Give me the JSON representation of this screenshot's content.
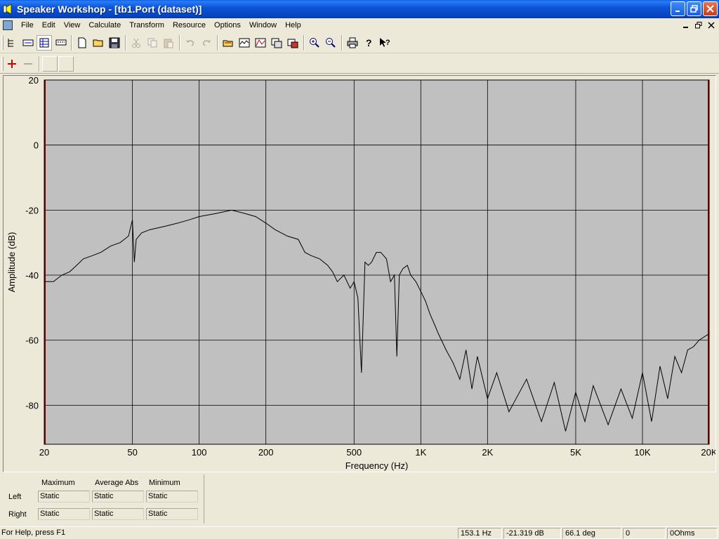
{
  "window": {
    "title": "Speaker Workshop - [tb1.Port (dataset)]"
  },
  "menu": {
    "items": [
      "File",
      "Edit",
      "View",
      "Calculate",
      "Transform",
      "Resource",
      "Options",
      "Window",
      "Help"
    ]
  },
  "toolbar": {
    "icons": [
      "tree-view-icon",
      "data-view-icon",
      "grid-view-icon",
      "list-view-icon",
      "new-file-icon",
      "open-folder-icon",
      "save-icon",
      "cut-icon",
      "copy-icon",
      "paste-icon",
      "undo-icon",
      "redo-icon",
      "open-dataset-icon",
      "graph-icon",
      "chart-icon",
      "window-icon",
      "record-icon",
      "zoom-in-icon",
      "zoom-out-icon",
      "print-icon",
      "help-icon",
      "context-help-icon"
    ],
    "row2_icons": [
      "add-icon",
      "subtract-icon",
      "blank-icon",
      "blank-icon"
    ]
  },
  "chart_data": {
    "type": "line",
    "title": "",
    "xlabel": "Frequency (Hz)",
    "ylabel": "Amplitude (dB)",
    "x_scale": "log",
    "xlim": [
      20,
      20000
    ],
    "ylim": [
      -92,
      20
    ],
    "x_ticks": [
      20,
      50,
      100,
      200,
      500,
      1000,
      2000,
      5000,
      10000,
      20000
    ],
    "x_tick_labels": [
      "20",
      "50",
      "100",
      "200",
      "500",
      "1K",
      "2K",
      "5K",
      "10K",
      "20K"
    ],
    "y_ticks": [
      20,
      0,
      -20,
      -40,
      -60,
      -80
    ],
    "y_tick_labels": [
      "20",
      "0",
      "-20",
      "-40",
      "-60",
      "-80"
    ],
    "grid": true,
    "background": "#c0c0c0",
    "line_color": "#000000",
    "marker_color": "#800000",
    "series": [
      {
        "x": [
          20,
          22,
          24,
          26,
          28,
          30,
          33,
          36,
          40,
          44,
          48,
          50,
          51,
          52,
          55,
          60,
          70,
          80,
          90,
          100,
          120,
          140,
          160,
          180,
          200,
          220,
          250,
          280,
          300,
          320,
          350,
          380,
          400,
          420,
          450,
          480,
          500,
          520,
          540,
          560,
          580,
          600,
          630,
          660,
          700,
          730,
          760,
          780,
          800,
          830,
          870,
          900,
          950,
          1000,
          1050,
          1100,
          1150,
          1200,
          1300,
          1400,
          1500,
          1600,
          1700,
          1800,
          2000,
          2200,
          2500,
          3000,
          3500,
          4000,
          4500,
          5000,
          5500,
          6000,
          7000,
          8000,
          9000,
          10000,
          11000,
          12000,
          13000,
          14000,
          15000,
          16000,
          17000,
          18000,
          20000
        ],
        "y": [
          -42,
          -42,
          -40,
          -39,
          -37,
          -35,
          -34,
          -33,
          -31,
          -30,
          -28,
          -23,
          -36,
          -29,
          -27,
          -26,
          -25,
          -24,
          -23,
          -22,
          -21,
          -20,
          -21,
          -22,
          -24,
          -26,
          -28,
          -29,
          -33,
          -34,
          -35,
          -37,
          -39,
          -42,
          -40,
          -44,
          -42,
          -47,
          -70,
          -36,
          -37,
          -36,
          -33,
          -33,
          -35,
          -42,
          -40,
          -65,
          -40,
          -38,
          -37,
          -40,
          -42,
          -45,
          -48,
          -52,
          -55,
          -58,
          -63,
          -67,
          -72,
          -63,
          -75,
          -65,
          -78,
          -70,
          -82,
          -72,
          -85,
          -73,
          -88,
          -76,
          -85,
          -74,
          -86,
          -75,
          -84,
          -70,
          -85,
          -68,
          -78,
          -65,
          -70,
          -63,
          -62,
          -60,
          -58
        ]
      }
    ]
  },
  "stats": {
    "headers": [
      "Maximum",
      "Average Abs",
      "Minimum"
    ],
    "rows": [
      {
        "label": "Left",
        "values": [
          "Static",
          "Static",
          "Static"
        ]
      },
      {
        "label": "Right",
        "values": [
          "Static",
          "Static",
          "Static"
        ]
      }
    ]
  },
  "status": {
    "help": "For Help, press F1",
    "frequency": "153.1 Hz",
    "amplitude": "-21.319 dB",
    "phase": "66.1 deg",
    "count": "0",
    "ohms": "0Ohms"
  }
}
